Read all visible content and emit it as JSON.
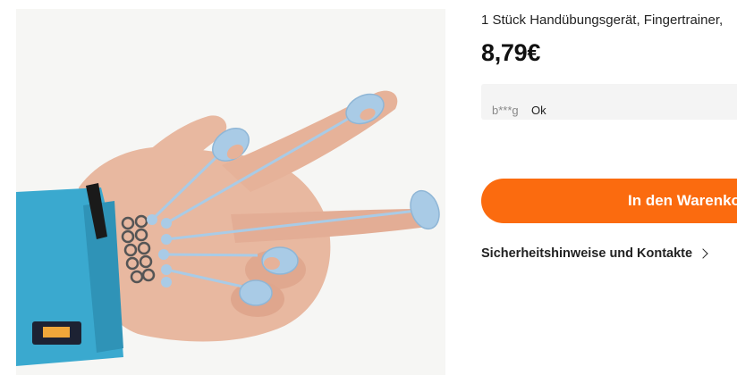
{
  "product": {
    "title": "1 Stück Handübungsgerät, Fingertrainer,",
    "price": "8,79€",
    "image_icon": "hand-finger-trainer-photo"
  },
  "review": {
    "user": "b***g",
    "text": "Ok"
  },
  "actions": {
    "add_to_cart_label": "In den Warenkorb",
    "safety_link_label": "Sicherheitshinweise und Kontakte"
  },
  "colors": {
    "accent": "#fb6b0f",
    "review_bg": "#f4f4f4",
    "strap": "#3aa9cf",
    "ring": "#a9cbe6"
  }
}
